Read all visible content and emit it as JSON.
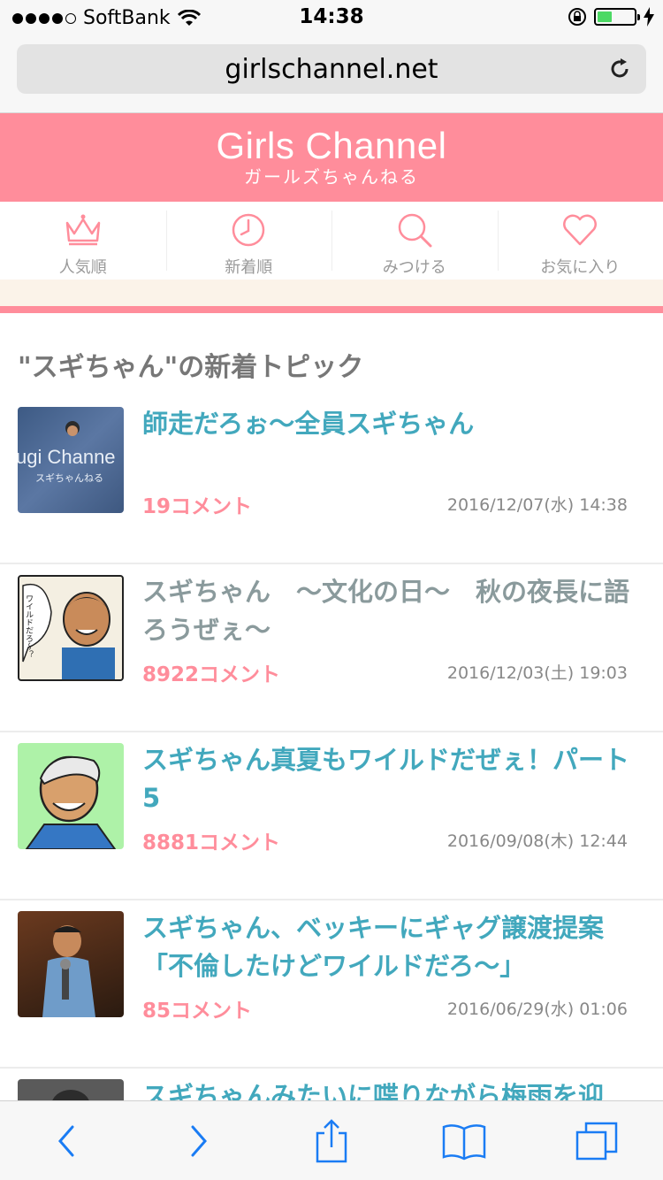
{
  "status": {
    "carrier": "SoftBank",
    "time": "14:38"
  },
  "browser": {
    "url": "girlschannel.net"
  },
  "site": {
    "logo": "Girls Channel",
    "logo_sub": "ガールズちゃんねる"
  },
  "nav": [
    {
      "label": "人気順",
      "icon": "crown-icon"
    },
    {
      "label": "新着順",
      "icon": "clock-icon"
    },
    {
      "label": "みつける",
      "icon": "search-icon"
    },
    {
      "label": "お気に入り",
      "icon": "heart-icon"
    }
  ],
  "section_title": "\"スギちゃん\"の新着トピック",
  "topics": [
    {
      "title": "師走だろぉ〜全員スギちゃん",
      "count": "19コメント",
      "date": "2016/12/07(水) 14:38",
      "visited": false,
      "thumb_text": "ugi Channe",
      "thumb_sub": "スギちゃんねる"
    },
    {
      "title": "スギちゃん　〜文化の日〜　秋の夜長に語ろうぜぇ〜",
      "count": "8922コメント",
      "date": "2016/12/03(土) 19:03",
      "visited": true,
      "thumb_text": "ワイルドだろ〜？"
    },
    {
      "title": "スギちゃん真夏もワイルドだぜぇ！パート5",
      "count": "8881コメント",
      "date": "2016/09/08(木) 12:44",
      "visited": false
    },
    {
      "title": "スギちゃん、ベッキーにギャグ譲渡提案「不倫したけどワイルドだろ〜」",
      "count": "85コメント",
      "date": "2016/06/29(水) 01:06",
      "visited": false
    },
    {
      "title": "スギちゃんみたいに喋りながら梅雨を迎",
      "count": "",
      "date": "",
      "visited": false
    }
  ],
  "colors": {
    "brand_pink": "#ff8d9b",
    "link_blue": "#42a8bd",
    "visited_gray": "#8a9a9c"
  }
}
